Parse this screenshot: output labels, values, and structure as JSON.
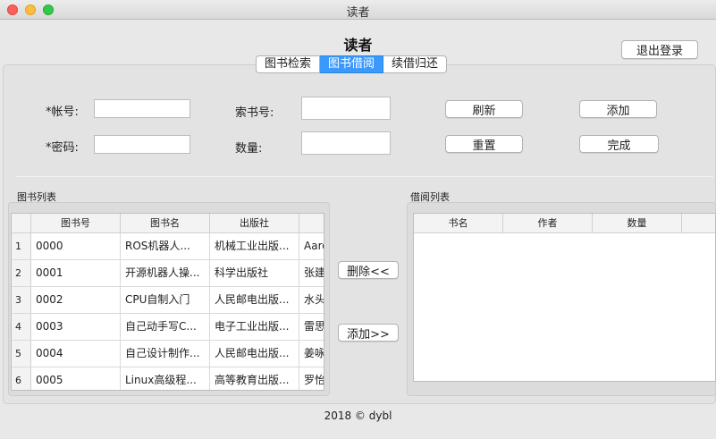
{
  "window": {
    "title": "读者",
    "controls": {
      "close": "close-icon",
      "minimize": "minimize-icon",
      "maximize": "maximize-icon"
    }
  },
  "header": {
    "title": "读者",
    "logout_label": "退出登录"
  },
  "tabs": [
    {
      "label": "图书检索",
      "active": false
    },
    {
      "label": "图书借阅",
      "active": true
    },
    {
      "label": "续借归还",
      "active": false
    }
  ],
  "form": {
    "account_label": "*帐号:",
    "account_value": "",
    "password_label": "*密码:",
    "password_value": "",
    "callno_label": "索书号:",
    "callno_value": "",
    "quantity_label": "数量:",
    "quantity_value": "",
    "refresh_label": "刷新",
    "add_label": "添加",
    "reset_label": "重置",
    "done_label": "完成"
  },
  "book_list": {
    "title": "图书列表",
    "columns": [
      "图书号",
      "图书名",
      "出版社",
      ""
    ],
    "rows": [
      {
        "index": "1",
        "id": "0000",
        "name": "ROS机器人...",
        "publisher": "机械工业出版...",
        "author": "Aaro"
      },
      {
        "index": "2",
        "id": "0001",
        "name": "开源机器人操...",
        "publisher": "科学出版社",
        "author": "张建"
      },
      {
        "index": "3",
        "id": "0002",
        "name": "CPU自制入门",
        "publisher": "人民邮电出版...",
        "author": "水头"
      },
      {
        "index": "4",
        "id": "0003",
        "name": "自己动手写C...",
        "publisher": "电子工业出版...",
        "author": "雷思"
      },
      {
        "index": "5",
        "id": "0004",
        "name": "自己设计制作...",
        "publisher": "人民邮电出版...",
        "author": "姜咏"
      },
      {
        "index": "6",
        "id": "0005",
        "name": "Linux高级程...",
        "publisher": "高等教育出版...",
        "author": "罗怡"
      }
    ]
  },
  "middle": {
    "delete_label": "删除<<",
    "add_label": "添加>>"
  },
  "borrow_list": {
    "title": "借阅列表",
    "columns": [
      "书名",
      "作者",
      "数量",
      ""
    ]
  },
  "footer": {
    "text": "2018 ©  dybl"
  },
  "colors": {
    "accent": "#3b99fc",
    "background": "#e8e8e8"
  }
}
